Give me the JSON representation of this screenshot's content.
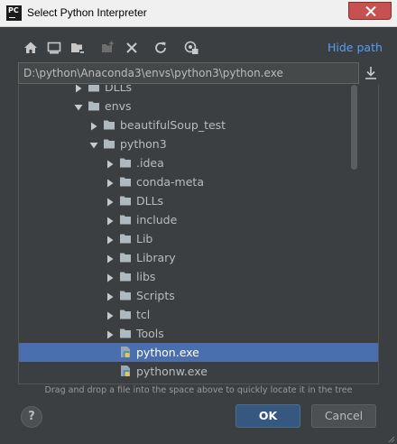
{
  "window": {
    "title": "Select Python Interpreter",
    "app_icon_text": "PC"
  },
  "toolbar": {
    "icons": [
      "home-icon",
      "desktop-icon",
      "project-folder-icon",
      "new-folder-icon",
      "delete-icon",
      "refresh-icon",
      "show-hidden-icon"
    ],
    "hide_path_label": "Hide path"
  },
  "path": {
    "value": "D:\\python\\Anaconda3\\envs\\python3\\python.exe"
  },
  "tree": {
    "rows": [
      {
        "label": "DLLs",
        "type": "folder",
        "expanded": false,
        "depth": 0
      },
      {
        "label": "envs",
        "type": "folder",
        "expanded": true,
        "depth": 0
      },
      {
        "label": "beautifulSoup_test",
        "type": "folder",
        "expanded": false,
        "depth": 1
      },
      {
        "label": "python3",
        "type": "folder",
        "expanded": true,
        "depth": 1
      },
      {
        "label": ".idea",
        "type": "folder",
        "expanded": false,
        "depth": 2
      },
      {
        "label": "conda-meta",
        "type": "folder",
        "expanded": false,
        "depth": 2
      },
      {
        "label": "DLLs",
        "type": "folder",
        "expanded": false,
        "depth": 2
      },
      {
        "label": "include",
        "type": "folder",
        "expanded": false,
        "depth": 2
      },
      {
        "label": "Lib",
        "type": "folder",
        "expanded": false,
        "depth": 2
      },
      {
        "label": "Library",
        "type": "folder",
        "expanded": false,
        "depth": 2
      },
      {
        "label": "libs",
        "type": "folder",
        "expanded": false,
        "depth": 2
      },
      {
        "label": "Scripts",
        "type": "folder",
        "expanded": false,
        "depth": 2
      },
      {
        "label": "tcl",
        "type": "folder",
        "expanded": false,
        "depth": 2
      },
      {
        "label": "Tools",
        "type": "folder",
        "expanded": false,
        "depth": 2
      },
      {
        "label": "python.exe",
        "type": "file",
        "selected": true,
        "depth": 2
      },
      {
        "label": "pythonw.exe",
        "type": "file",
        "selected": false,
        "depth": 2
      }
    ]
  },
  "hint": "Drag and drop a file into the space above to quickly locate it in the tree",
  "footer": {
    "help_label": "?",
    "ok_label": "OK",
    "cancel_label": "Cancel"
  },
  "colors": {
    "background": "#3c3f41",
    "selection": "#4b6eaf",
    "link": "#589df6",
    "ok_button": "#365880"
  }
}
